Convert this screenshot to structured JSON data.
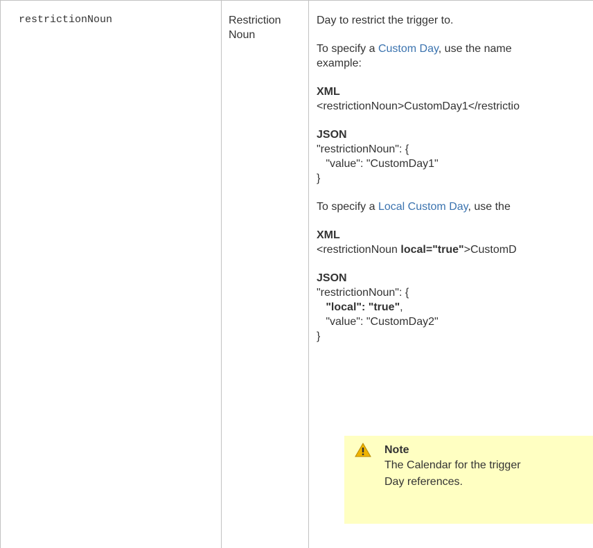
{
  "row": {
    "name": "restrictionNoun",
    "ui_field": "Restriction Noun",
    "description": {
      "intro": "Day to restrict the trigger to.",
      "custom_day": {
        "prefix": "To specify a ",
        "link": "Custom Day",
        "suffix": ", use the name",
        "next_line": "example:"
      },
      "xml1": {
        "label": "XML",
        "code": "<restrictionNoun>CustomDay1</restrictio"
      },
      "json1": {
        "label": "JSON",
        "line1": "\"restrictionNoun\": {",
        "line2": "\"value\": \"CustomDay1\"",
        "line3": "}"
      },
      "local_custom_day": {
        "prefix": "To specify a ",
        "link": "Local Custom Day",
        "suffix": ", use the"
      },
      "xml2": {
        "label": "XML",
        "code_start": "<restrictionNoun ",
        "code_bold": "local=\"true\"",
        "code_end": ">CustomD"
      },
      "json2": {
        "label": "JSON",
        "line1": "\"restrictionNoun\": {",
        "line2_bold": "\"local\": \"true\"",
        "line2_end": ",",
        "line3": "\"value\": \"CustomDay2\"",
        "line4": "}"
      }
    },
    "note": {
      "icon": "warning-icon",
      "title": "Note",
      "line1": "The Calendar for the trigger",
      "line2": "Day references."
    }
  },
  "colors": {
    "border": "#c1c1c1",
    "link": "#3b73af",
    "note_bg": "#ffffc2",
    "warning": "#f0b400"
  }
}
